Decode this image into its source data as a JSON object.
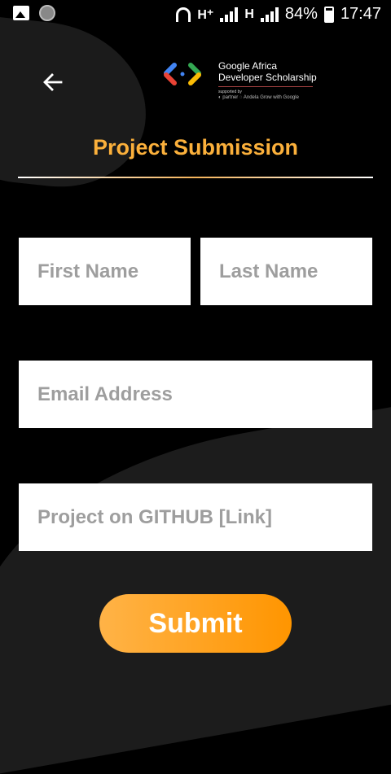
{
  "status_bar": {
    "network_1": "H⁺",
    "network_2": "H",
    "battery": "84%",
    "time": "17:47"
  },
  "header": {
    "logo_title_line1": "Google Africa",
    "logo_title_line2": "Developer Scholarship",
    "logo_supported_by": "supported by",
    "logo_partners": "◐ partner   ◌ Andela   Grow with Google"
  },
  "page": {
    "title": "Project Submission"
  },
  "form": {
    "first_name_placeholder": "First Name",
    "last_name_placeholder": "Last Name",
    "email_placeholder": "Email Address",
    "github_placeholder": "Project on GITHUB [Link]",
    "submit_label": "Submit"
  },
  "colors": {
    "accent": "#fbb03b",
    "button_start": "#ffb347",
    "button_end": "#ff9500",
    "placeholder": "#9e9e9e",
    "background": "#000000"
  },
  "icons": {
    "back": "arrow-left-icon",
    "gallery": "image-icon",
    "headset": "headset-icon",
    "signal": "signal-bars-icon",
    "battery": "battery-charging-icon"
  }
}
